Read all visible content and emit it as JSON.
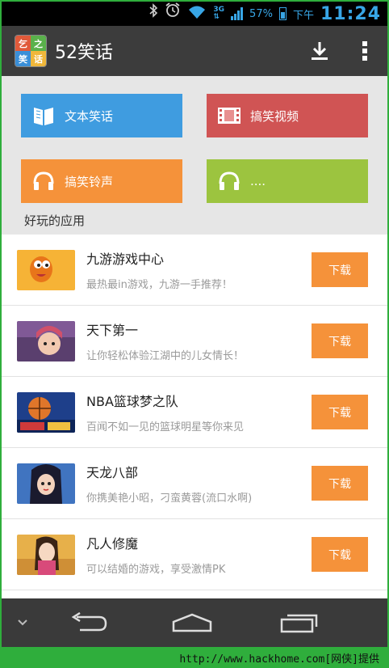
{
  "status_bar": {
    "network": "3G",
    "battery_text": "57%",
    "battery_level": 0.57,
    "ampm": "下午",
    "time": "11:24"
  },
  "action_bar": {
    "logo_chars": [
      "乞",
      "之",
      "笑",
      "话"
    ],
    "title": "52笑话"
  },
  "tiles": [
    {
      "label": "文本笑话",
      "icon": "book-icon",
      "color": "#3f9ce0"
    },
    {
      "label": "搞笑视频",
      "icon": "film-icon",
      "color": "#d05454"
    },
    {
      "label": "搞笑铃声",
      "icon": "headphones-icon",
      "color": "#f5923a"
    },
    {
      "label": "....",
      "icon": "headphones-icon",
      "color": "#9cc43f"
    }
  ],
  "section_title": "好玩的应用",
  "apps": [
    {
      "name": "九游游戏中心",
      "desc": "最热最in游戏，九游一手推荐！",
      "button": "下载"
    },
    {
      "name": "天下第一",
      "desc": "让你轻松体验江湖中的儿女情长！",
      "button": "下载"
    },
    {
      "name": "NBA篮球梦之队",
      "desc": "百闻不如一见的篮球明星等你来见",
      "button": "下载"
    },
    {
      "name": "天龙八部",
      "desc": "你携美艳小昭，刁蛮黄蓉(流口水啊)",
      "button": "下载"
    },
    {
      "name": "凡人修魔",
      "desc": "可以结婚的游戏，享受激情PK",
      "button": "下载"
    }
  ],
  "footer_text": "http://www.hackhome.com[网侠]提供",
  "colors": {
    "accent_orange": "#f5923a",
    "blue": "#3f9ce0",
    "red": "#d05454",
    "green": "#9cc43f",
    "frame_green": "#2fae3c"
  }
}
